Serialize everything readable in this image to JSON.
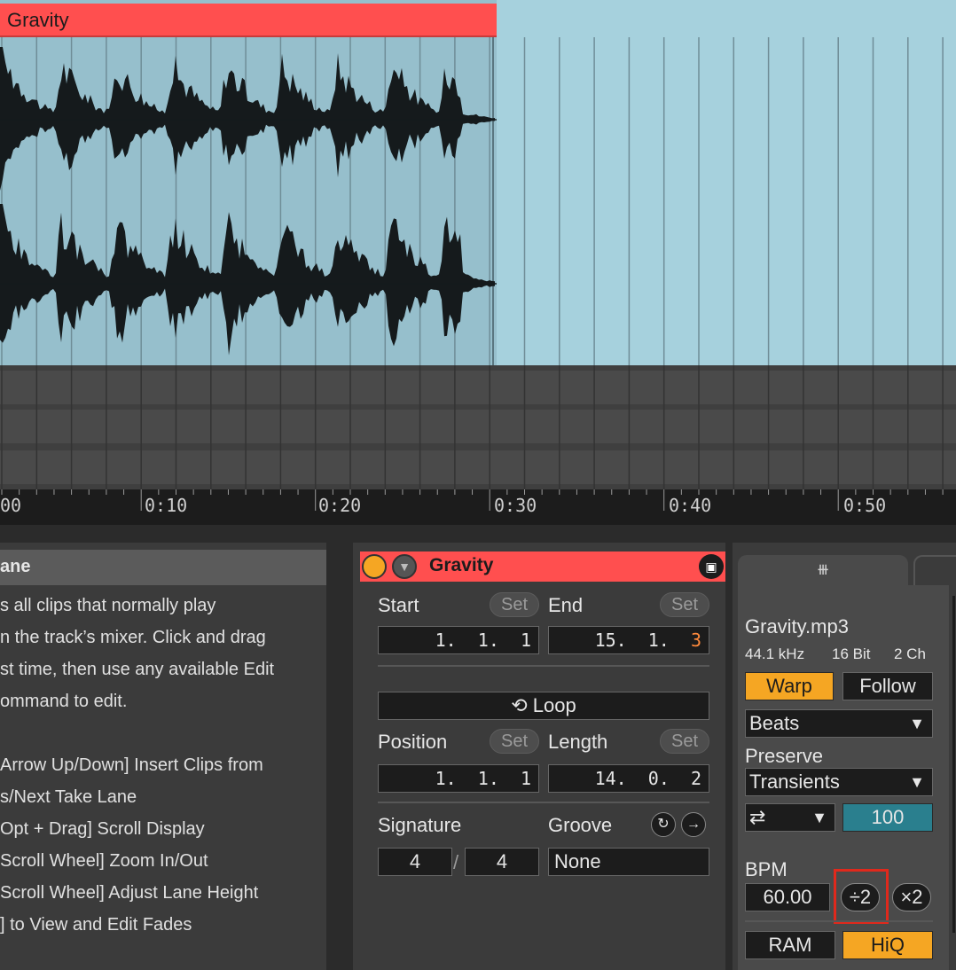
{
  "colors": {
    "clip_red": "#ff4f4f",
    "lane_blue": "#a6d1dd",
    "clip_blue": "#96bfcc",
    "warp_orange": "#f5a623",
    "teal_value": "#2a7f8e",
    "highlight_red": "#e0291c"
  },
  "clip": {
    "title": "Gravity"
  },
  "ruler": {
    "labels": [
      "00",
      "0:10",
      "0:20",
      "0:30",
      "0:40",
      "0:50"
    ]
  },
  "info": {
    "title": "ane",
    "lines": [
      "s all clips that normally play",
      "n the track’s mixer. Click and drag",
      "st time, then use any available Edit",
      "ommand to edit.",
      "",
      "Arrow Up/Down] Insert Clips from",
      "s/Next Take Lane",
      "Opt + Drag] Scroll Display",
      "Scroll Wheel] Zoom In/Out",
      "Scroll Wheel] Adjust Lane Height",
      "] to View and Edit Fades"
    ]
  },
  "clip_panel": {
    "title": "Gravity",
    "start_label": "Start",
    "end_label": "End",
    "set_label": "Set",
    "start_value": "1.  1.  1",
    "end_value": "15.  1.",
    "end_value_last": "3",
    "loop_label": "Loop",
    "position_label": "Position",
    "length_label": "Length",
    "position_value": "1.  1.  1",
    "length_value": "14.  0.  2",
    "signature_label": "Signature",
    "groove_label": "Groove",
    "sig_numerator": "4",
    "sig_slash": "/",
    "sig_denominator": "4",
    "groove_value": "None"
  },
  "sample_panel": {
    "tab_icon": "waveform-icon",
    "filename": "Gravity.mp3",
    "sample_rate": "44.1 kHz",
    "bit_depth": "16 Bit",
    "channels": "2 Ch",
    "warp_label": "Warp",
    "follow_label": "Follow",
    "warp_mode": "Beats",
    "preserve_label": "Preserve",
    "preserve_value": "Transients",
    "loop_mode_icon": "⇄",
    "envelope_value": "100",
    "bpm_label": "BPM",
    "bpm_value": "60.00",
    "half_label": "÷2",
    "double_label": "×2",
    "ram_label": "RAM",
    "hiq_label": "HiQ"
  }
}
